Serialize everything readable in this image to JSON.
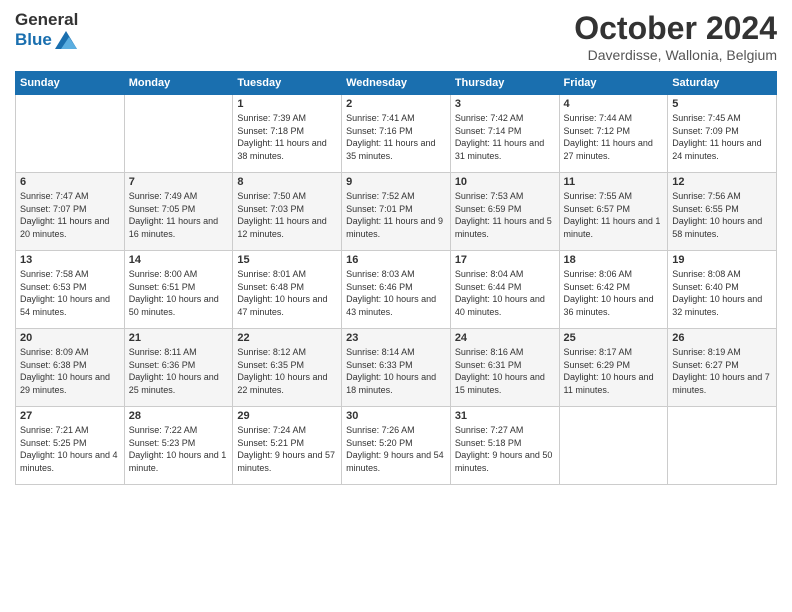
{
  "header": {
    "logo_line1": "General",
    "logo_line2": "Blue",
    "month": "October 2024",
    "location": "Daverdisse, Wallonia, Belgium"
  },
  "days_of_week": [
    "Sunday",
    "Monday",
    "Tuesday",
    "Wednesday",
    "Thursday",
    "Friday",
    "Saturday"
  ],
  "weeks": [
    [
      {
        "day": "",
        "sunrise": "",
        "sunset": "",
        "daylight": ""
      },
      {
        "day": "",
        "sunrise": "",
        "sunset": "",
        "daylight": ""
      },
      {
        "day": "1",
        "sunrise": "Sunrise: 7:39 AM",
        "sunset": "Sunset: 7:18 PM",
        "daylight": "Daylight: 11 hours and 38 minutes."
      },
      {
        "day": "2",
        "sunrise": "Sunrise: 7:41 AM",
        "sunset": "Sunset: 7:16 PM",
        "daylight": "Daylight: 11 hours and 35 minutes."
      },
      {
        "day": "3",
        "sunrise": "Sunrise: 7:42 AM",
        "sunset": "Sunset: 7:14 PM",
        "daylight": "Daylight: 11 hours and 31 minutes."
      },
      {
        "day": "4",
        "sunrise": "Sunrise: 7:44 AM",
        "sunset": "Sunset: 7:12 PM",
        "daylight": "Daylight: 11 hours and 27 minutes."
      },
      {
        "day": "5",
        "sunrise": "Sunrise: 7:45 AM",
        "sunset": "Sunset: 7:09 PM",
        "daylight": "Daylight: 11 hours and 24 minutes."
      }
    ],
    [
      {
        "day": "6",
        "sunrise": "Sunrise: 7:47 AM",
        "sunset": "Sunset: 7:07 PM",
        "daylight": "Daylight: 11 hours and 20 minutes."
      },
      {
        "day": "7",
        "sunrise": "Sunrise: 7:49 AM",
        "sunset": "Sunset: 7:05 PM",
        "daylight": "Daylight: 11 hours and 16 minutes."
      },
      {
        "day": "8",
        "sunrise": "Sunrise: 7:50 AM",
        "sunset": "Sunset: 7:03 PM",
        "daylight": "Daylight: 11 hours and 12 minutes."
      },
      {
        "day": "9",
        "sunrise": "Sunrise: 7:52 AM",
        "sunset": "Sunset: 7:01 PM",
        "daylight": "Daylight: 11 hours and 9 minutes."
      },
      {
        "day": "10",
        "sunrise": "Sunrise: 7:53 AM",
        "sunset": "Sunset: 6:59 PM",
        "daylight": "Daylight: 11 hours and 5 minutes."
      },
      {
        "day": "11",
        "sunrise": "Sunrise: 7:55 AM",
        "sunset": "Sunset: 6:57 PM",
        "daylight": "Daylight: 11 hours and 1 minute."
      },
      {
        "day": "12",
        "sunrise": "Sunrise: 7:56 AM",
        "sunset": "Sunset: 6:55 PM",
        "daylight": "Daylight: 10 hours and 58 minutes."
      }
    ],
    [
      {
        "day": "13",
        "sunrise": "Sunrise: 7:58 AM",
        "sunset": "Sunset: 6:53 PM",
        "daylight": "Daylight: 10 hours and 54 minutes."
      },
      {
        "day": "14",
        "sunrise": "Sunrise: 8:00 AM",
        "sunset": "Sunset: 6:51 PM",
        "daylight": "Daylight: 10 hours and 50 minutes."
      },
      {
        "day": "15",
        "sunrise": "Sunrise: 8:01 AM",
        "sunset": "Sunset: 6:48 PM",
        "daylight": "Daylight: 10 hours and 47 minutes."
      },
      {
        "day": "16",
        "sunrise": "Sunrise: 8:03 AM",
        "sunset": "Sunset: 6:46 PM",
        "daylight": "Daylight: 10 hours and 43 minutes."
      },
      {
        "day": "17",
        "sunrise": "Sunrise: 8:04 AM",
        "sunset": "Sunset: 6:44 PM",
        "daylight": "Daylight: 10 hours and 40 minutes."
      },
      {
        "day": "18",
        "sunrise": "Sunrise: 8:06 AM",
        "sunset": "Sunset: 6:42 PM",
        "daylight": "Daylight: 10 hours and 36 minutes."
      },
      {
        "day": "19",
        "sunrise": "Sunrise: 8:08 AM",
        "sunset": "Sunset: 6:40 PM",
        "daylight": "Daylight: 10 hours and 32 minutes."
      }
    ],
    [
      {
        "day": "20",
        "sunrise": "Sunrise: 8:09 AM",
        "sunset": "Sunset: 6:38 PM",
        "daylight": "Daylight: 10 hours and 29 minutes."
      },
      {
        "day": "21",
        "sunrise": "Sunrise: 8:11 AM",
        "sunset": "Sunset: 6:36 PM",
        "daylight": "Daylight: 10 hours and 25 minutes."
      },
      {
        "day": "22",
        "sunrise": "Sunrise: 8:12 AM",
        "sunset": "Sunset: 6:35 PM",
        "daylight": "Daylight: 10 hours and 22 minutes."
      },
      {
        "day": "23",
        "sunrise": "Sunrise: 8:14 AM",
        "sunset": "Sunset: 6:33 PM",
        "daylight": "Daylight: 10 hours and 18 minutes."
      },
      {
        "day": "24",
        "sunrise": "Sunrise: 8:16 AM",
        "sunset": "Sunset: 6:31 PM",
        "daylight": "Daylight: 10 hours and 15 minutes."
      },
      {
        "day": "25",
        "sunrise": "Sunrise: 8:17 AM",
        "sunset": "Sunset: 6:29 PM",
        "daylight": "Daylight: 10 hours and 11 minutes."
      },
      {
        "day": "26",
        "sunrise": "Sunrise: 8:19 AM",
        "sunset": "Sunset: 6:27 PM",
        "daylight": "Daylight: 10 hours and 7 minutes."
      }
    ],
    [
      {
        "day": "27",
        "sunrise": "Sunrise: 7:21 AM",
        "sunset": "Sunset: 5:25 PM",
        "daylight": "Daylight: 10 hours and 4 minutes."
      },
      {
        "day": "28",
        "sunrise": "Sunrise: 7:22 AM",
        "sunset": "Sunset: 5:23 PM",
        "daylight": "Daylight: 10 hours and 1 minute."
      },
      {
        "day": "29",
        "sunrise": "Sunrise: 7:24 AM",
        "sunset": "Sunset: 5:21 PM",
        "daylight": "Daylight: 9 hours and 57 minutes."
      },
      {
        "day": "30",
        "sunrise": "Sunrise: 7:26 AM",
        "sunset": "Sunset: 5:20 PM",
        "daylight": "Daylight: 9 hours and 54 minutes."
      },
      {
        "day": "31",
        "sunrise": "Sunrise: 7:27 AM",
        "sunset": "Sunset: 5:18 PM",
        "daylight": "Daylight: 9 hours and 50 minutes."
      },
      {
        "day": "",
        "sunrise": "",
        "sunset": "",
        "daylight": ""
      },
      {
        "day": "",
        "sunrise": "",
        "sunset": "",
        "daylight": ""
      }
    ]
  ]
}
